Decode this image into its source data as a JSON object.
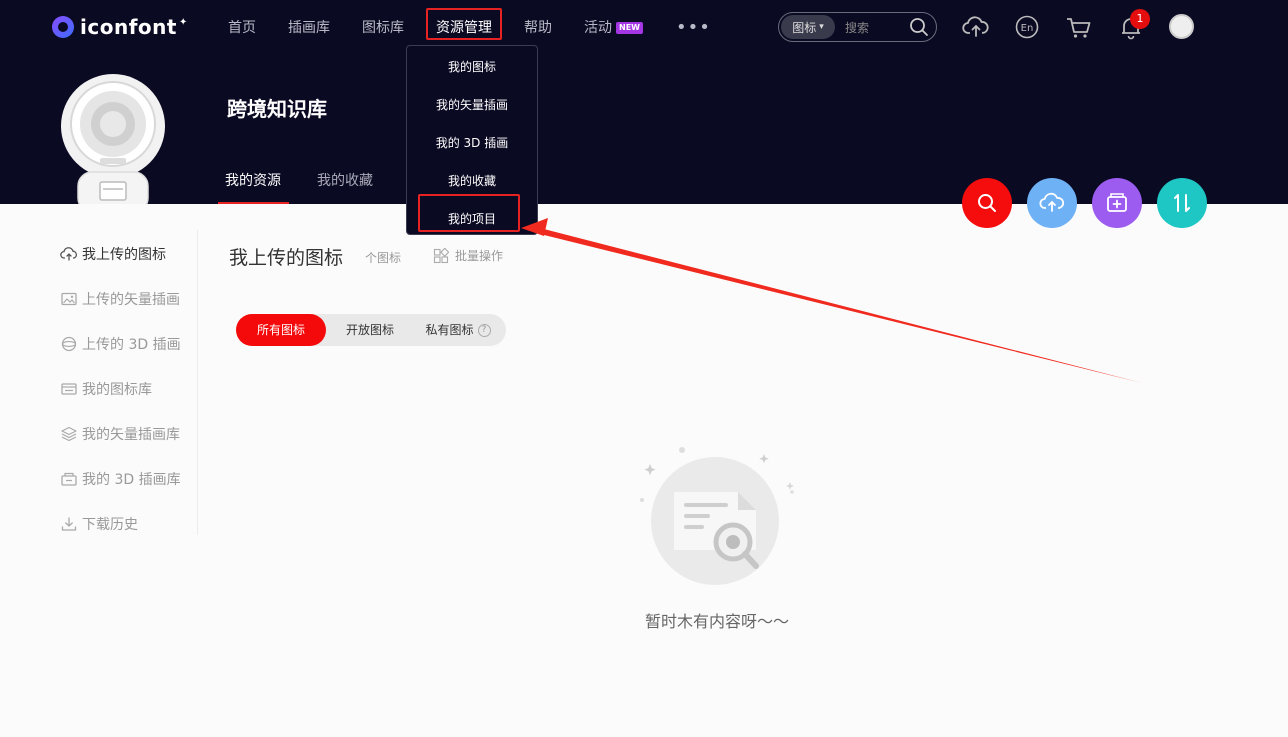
{
  "header": {
    "logo_text": "iconfont",
    "logo_star": "✦",
    "nav": [
      {
        "label": "首页"
      },
      {
        "label": "插画库"
      },
      {
        "label": "图标库"
      },
      {
        "label": "资源管理"
      },
      {
        "label": "帮助"
      },
      {
        "label": "活动"
      }
    ],
    "new_badge": "NEW",
    "more": "•••",
    "search": {
      "type": "图标",
      "placeholder": "搜索"
    },
    "notification_count": "1"
  },
  "dropdown": {
    "items": [
      "我的图标",
      "我的矢量插画",
      "我的 3D 插画",
      "我的收藏",
      "我的项目"
    ]
  },
  "profile": {
    "name": "跨境知识库",
    "tabs": [
      "我的资源",
      "我的收藏"
    ]
  },
  "sidebar": {
    "items": [
      "我上传的图标",
      "上传的矢量插画",
      "上传的 3D 插画",
      "我的图标库",
      "我的矢量插画库",
      "我的 3D 插画库",
      "下载历史"
    ]
  },
  "content": {
    "title": "我上传的图标",
    "count": "个图标",
    "batch": "批量操作",
    "filters": [
      "所有图标",
      "开放图标",
      "私有图标"
    ],
    "help": "?",
    "empty_text": "暂时木有内容呀～～"
  },
  "colors": {
    "header_bg": "#0b0a23",
    "accent_red": "#f40a0a",
    "fab_search": "#f50d0d",
    "fab_upload": "#6fb1f5",
    "fab_library": "#9c5cf0",
    "fab_sort": "#1ec6c4"
  }
}
